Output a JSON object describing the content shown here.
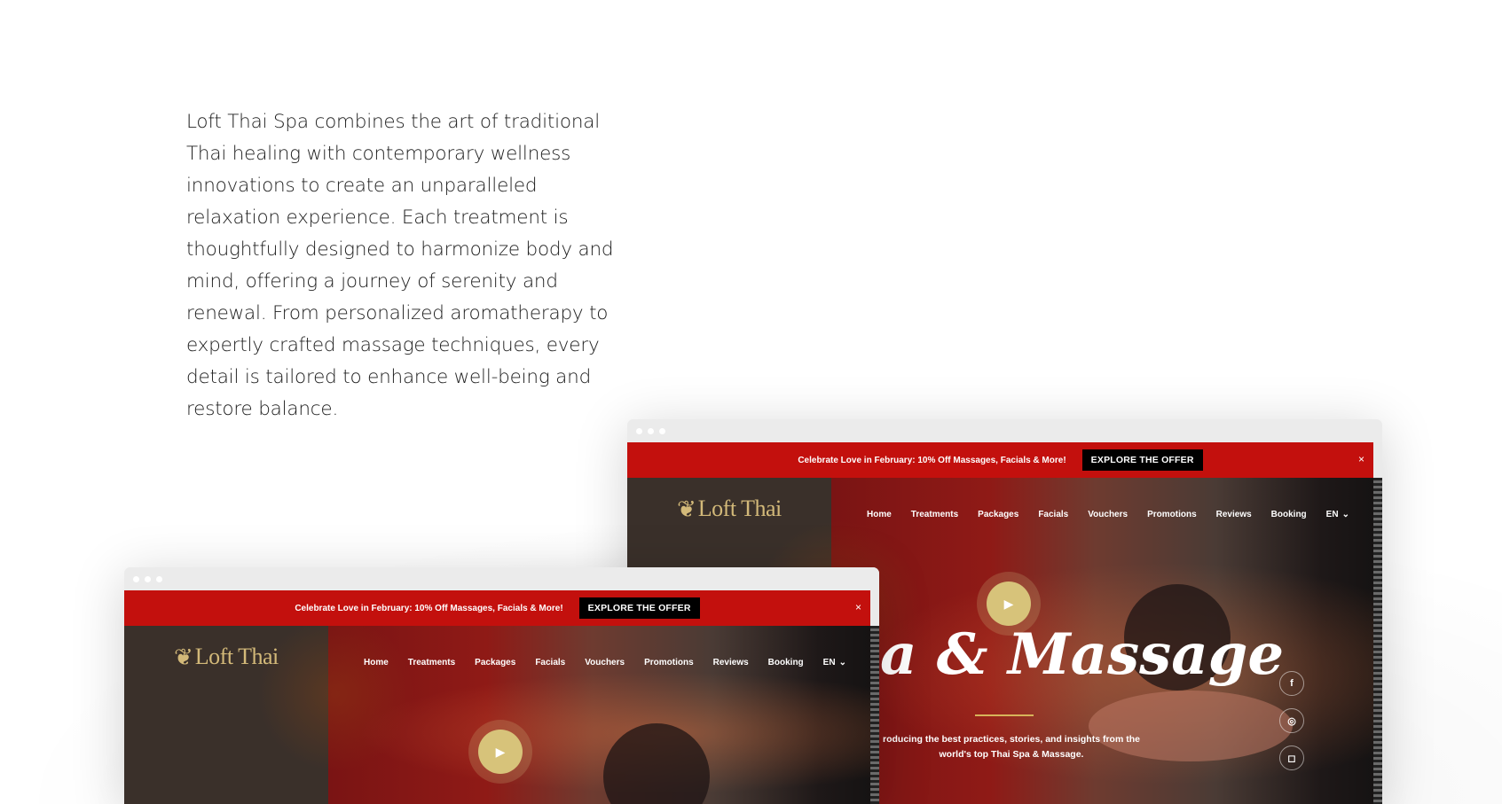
{
  "intro": {
    "text": "Loft Thai Spa combines the art of traditional Thai healing with contemporary wellness innovations to create an unparalleled relaxation experience. Each treatment is thoughtfully designed to harmonize body and mind, offering a journey of serenity and renewal. From personalized aromatherapy to expertly crafted massage techniques, every detail is tailored to enhance well-being and restore balance."
  },
  "site": {
    "promo_text": "Celebrate Love in February: 10% Off Massages, Facials & More!",
    "promo_button": "EXPLORE THE OFFER",
    "promo_close": "×",
    "logo": "Loft Thai",
    "nav": [
      "Home",
      "Treatments",
      "Packages",
      "Facials",
      "Vouchers",
      "Promotions",
      "Reviews",
      "Booking"
    ],
    "lang": "EN",
    "lang_caret": "⌄",
    "play_icon": "▶",
    "headline": "a & Massage",
    "subheadline": "roducing the best practices, stories, and insights from the world's top Thai Spa & Massage.",
    "social": [
      "f",
      "◎",
      "◻"
    ]
  },
  "colors": {
    "promo_red": "#c3100d",
    "gold": "#d7c37a",
    "logo_gold": "#d3b979"
  }
}
